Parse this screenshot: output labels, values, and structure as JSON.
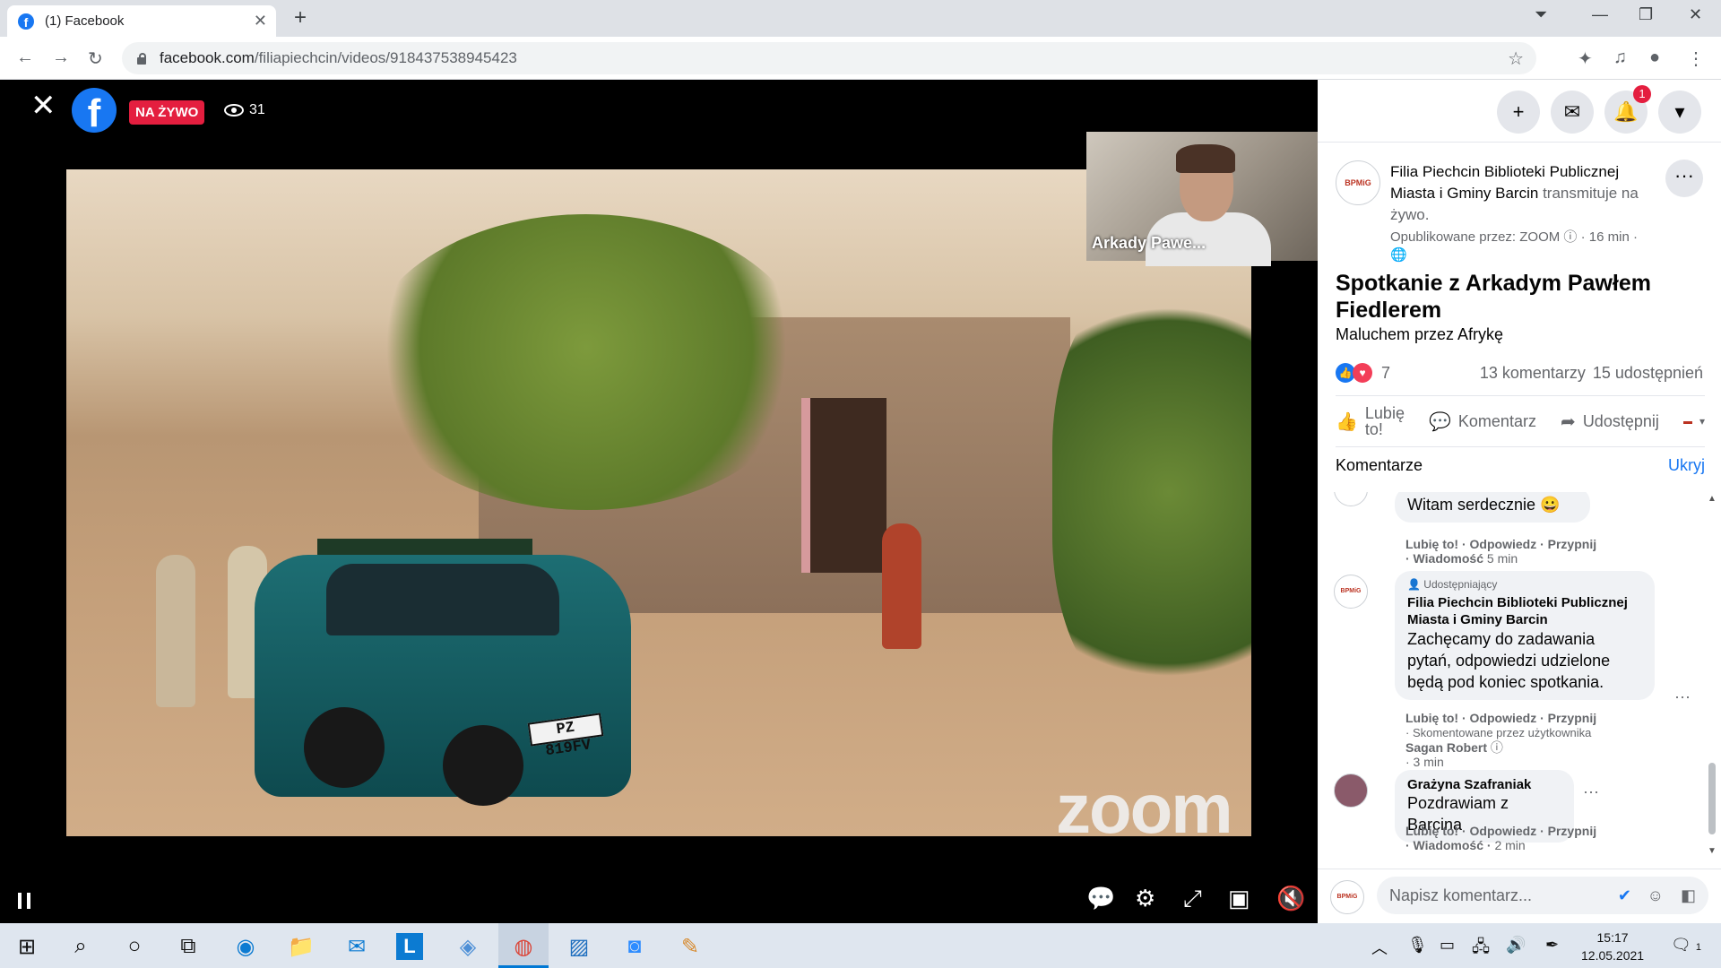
{
  "browser": {
    "tab_title": "(1) Facebook",
    "url_host": "facebook.com",
    "url_path": "/filiapiechcin/videos/918437538945423"
  },
  "video": {
    "live_label": "NA ŻYWO",
    "viewer_count": "31",
    "pip_name": "Arkady Pawe...",
    "watermark": "zoom",
    "plate": "PZ 819FV"
  },
  "sidebar": {
    "notification_count": "1",
    "page_name": "Filia Piechcin Biblioteki Publicznej Miasta i Gminy Barcin",
    "action_text": "transmituje na żywo.",
    "published_by": "Opublikowane przez: ZOOM",
    "time_ago": "16 min",
    "video_title": "Spotkanie z Arkadym Pawłem Fiedlerem",
    "video_subtitle": "Maluchem przez Afrykę",
    "reaction_count": "7",
    "comments_count": "13 komentarzy",
    "shares_count": "15 udostępnień",
    "actions": {
      "like": "Lubię to!",
      "comment": "Komentarz",
      "share": "Udostępnij"
    },
    "comments_header": "Komentarze",
    "hide_label": "Ukryj",
    "composer_placeholder": "Napisz komentarz...",
    "avatar_text": "BPMiG"
  },
  "comments": [
    {
      "text": "Witam serdecznie 😀",
      "reply": "Lubię to! · Odpowiedz · Przypnij",
      "line2": "· Wiadomość",
      "time": "5 min"
    },
    {
      "badge": "Udostępniający",
      "author": "Filia Piechcin Biblioteki Publicznej Miasta i Gminy Barcin",
      "text": "Zachęcamy do zadawania pytań, odpowiedzi udzielone będą pod koniec spotkania.",
      "reply": "Lubię to! · Odpowiedz · Przypnij",
      "commented_by": "· Skomentowane przez użytkownika",
      "commenter": "Sagan Robert",
      "time": "· 3 min"
    },
    {
      "author": "Grażyna Szafraniak",
      "text": "Pozdrawiam z Barcina",
      "reply": "Lubię to! · Odpowiedz · Przypnij",
      "line2": "· Wiadomość",
      "time": "2 min"
    }
  ],
  "taskbar": {
    "time": "15:17",
    "date": "12.05.2021",
    "action_center_count": "1"
  },
  "colors": {
    "facebook_blue": "#1877f2",
    "live_red": "#e41e3f"
  }
}
